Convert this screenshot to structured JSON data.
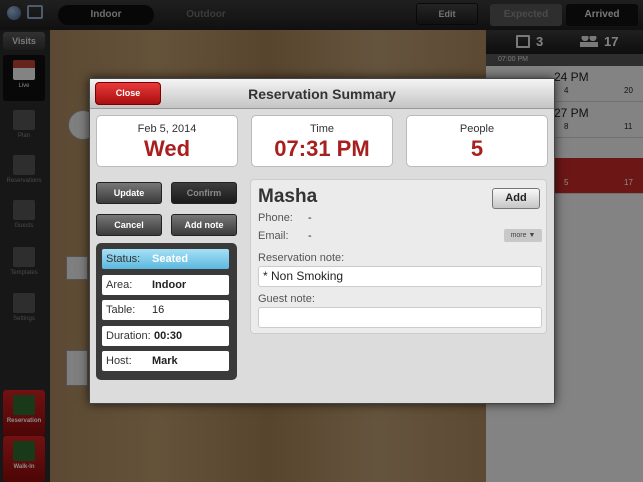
{
  "topbar": {
    "tabs": [
      "Indoor",
      "Outdoor"
    ],
    "edit_label": "Edit",
    "right_tabs": [
      "Expected",
      "Arrived"
    ]
  },
  "sidebar": {
    "visits_label": "Visits",
    "items": [
      {
        "label": "Live",
        "icon": "live-icon"
      },
      {
        "label": "Plan",
        "icon": "plan-icon"
      },
      {
        "label": "Reservations",
        "icon": "calendar-icon"
      },
      {
        "label": "Guests",
        "icon": "guests-icon"
      },
      {
        "label": "Templates",
        "icon": "templates-icon"
      },
      {
        "label": "Settings",
        "icon": "gear-icon"
      }
    ],
    "actions": [
      {
        "label": "Reservation",
        "icon": "add-reservation-icon"
      },
      {
        "label": "Walk-In",
        "icon": "walk-in-icon"
      }
    ]
  },
  "right_panel": {
    "reservations_count": "3",
    "people_count": "17",
    "time_header": "07:00 PM",
    "rows": [
      {
        "time": "24 PM",
        "guests": "4",
        "tables": "20"
      },
      {
        "time": "27 PM",
        "guests": "8",
        "tables": "11"
      },
      {
        "time": "",
        "guests": "5",
        "tables": "17"
      }
    ]
  },
  "modal": {
    "title": "Reservation Summary",
    "close_label": "Close",
    "date_label": "Feb 5, 2014",
    "weekday": "Wed",
    "time_label": "Time",
    "time_value": "07:31 PM",
    "people_label": "People",
    "people_value": "5",
    "buttons": {
      "update": "Update",
      "confirm": "Confirm",
      "cancel": "Cancel",
      "add_note": "Add note"
    },
    "status": {
      "status_key": "Status:",
      "status_val": "Seated",
      "area_key": "Area:",
      "area_val": "Indoor",
      "table_key": "Table:",
      "table_val": "16",
      "duration_key": "Duration:",
      "duration_val": "00:30",
      "host_key": "Host:",
      "host_val": "Mark"
    },
    "guest": {
      "name": "Masha",
      "add_label": "Add",
      "phone_label": "Phone:",
      "phone_value": "-",
      "email_label": "Email:",
      "email_value": "-",
      "more_label": "more ▼",
      "reservation_note_label": "Reservation note:",
      "reservation_note": "* Non Smoking",
      "guest_note_label": "Guest note:",
      "guest_note": ""
    }
  },
  "colors": {
    "accent_red": "#a81f1f",
    "close_red": "#d32525",
    "status_blue": "#5cb8de"
  }
}
